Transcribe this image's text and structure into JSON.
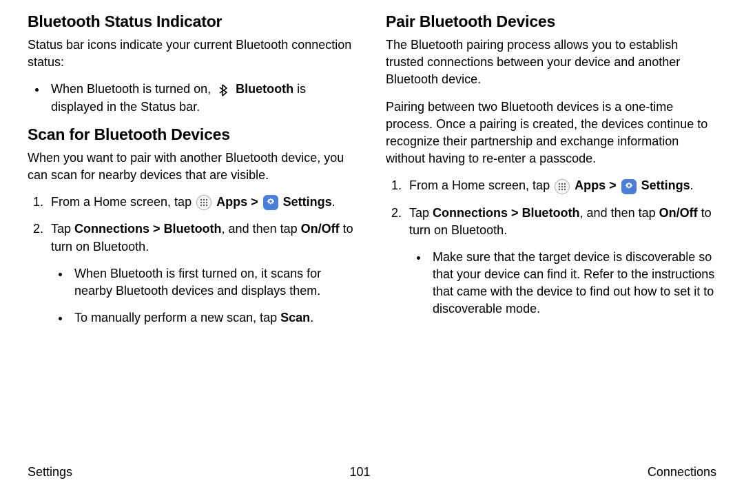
{
  "left": {
    "section1": {
      "heading": "Bluetooth Status Indicator",
      "intro": "Status bar icons indicate your current Bluetooth connection status:",
      "bullet1_pre": "When Bluetooth is turned on, ",
      "bullet1_bold": "Bluetooth",
      "bullet1_post": " is displayed in the Status bar."
    },
    "section2": {
      "heading": "Scan for Bluetooth Devices",
      "intro": "When you want to pair with another Bluetooth device, you can scan for nearby devices that are visible.",
      "step1_pre": "From a Home screen, tap ",
      "step1_apps": "Apps",
      "step1_sep": " > ",
      "step1_settings": "Settings",
      "step1_post": ".",
      "step2_pre": "Tap ",
      "step2_b1": "Connections",
      "step2_sep1": " > ",
      "step2_b2": "Bluetooth",
      "step2_mid": ", and then tap ",
      "step2_b3": "On/Off",
      "step2_post": " to turn on Bluetooth.",
      "sub1": "When Bluetooth is first turned on, it scans for nearby Bluetooth devices and displays them.",
      "sub2_pre": "To manually perform a new scan, tap ",
      "sub2_bold": "Scan",
      "sub2_post": "."
    }
  },
  "right": {
    "section1": {
      "heading": "Pair Bluetooth Devices",
      "p1": "The Bluetooth pairing process allows you to establish trusted connections between your device and another Bluetooth device.",
      "p2": "Pairing between two Bluetooth devices is a one-time process. Once a pairing is created, the devices continue to recognize their partnership and exchange information without having to re-enter a passcode.",
      "step1_pre": "From a Home screen, tap ",
      "step1_apps": "Apps",
      "step1_sep": " > ",
      "step1_settings": "Settings",
      "step1_post": ".",
      "step2_pre": "Tap ",
      "step2_b1": "Connections",
      "step2_sep1": " > ",
      "step2_b2": "Bluetooth",
      "step2_mid": ", and then tap ",
      "step2_b3": "On/Off",
      "step2_post": " to turn on Bluetooth.",
      "sub1": "Make sure that the target device is discoverable so that your device can find it. Refer to the instructions that came with the device to find out how to set it to discoverable mode."
    }
  },
  "footer": {
    "left": "Settings",
    "center": "101",
    "right": "Connections"
  }
}
